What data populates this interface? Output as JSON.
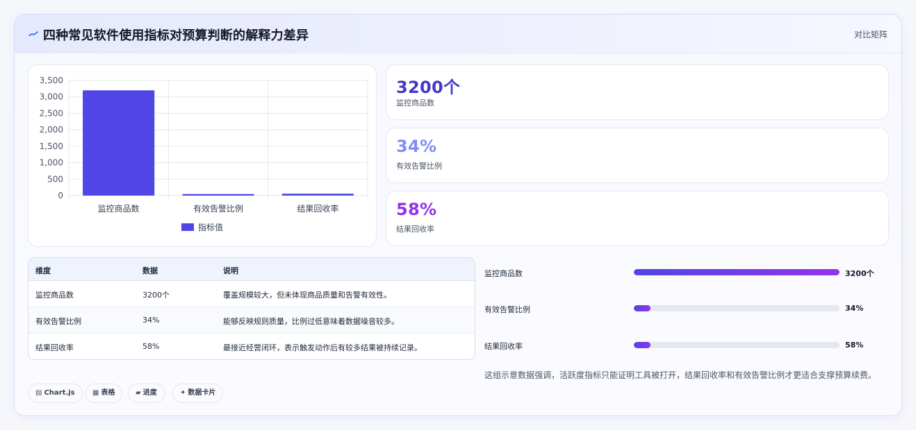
{
  "header": {
    "title": "四种常见软件使用指标对预算判断的解释力差异",
    "tag": "对比矩阵"
  },
  "chart_data": {
    "type": "bar",
    "categories": [
      "监控商品数",
      "有效告警比例",
      "结果回收率"
    ],
    "series": [
      {
        "name": "指标值",
        "values": [
          3200,
          34,
          58
        ]
      }
    ],
    "ylim": [
      0,
      3500
    ],
    "yticks": [
      0,
      500,
      1000,
      1500,
      2000,
      2500,
      3000,
      3500
    ],
    "ytick_labels": [
      "0",
      "500",
      "1,000",
      "1,500",
      "2,000",
      "2,500",
      "3,000",
      "3,500"
    ],
    "grid": true,
    "legend": "bottom",
    "color": "#4f46e5"
  },
  "kpis": [
    {
      "value": "3200个",
      "label": "监控商品数",
      "color": "#4338ca"
    },
    {
      "value": "34%",
      "label": "有效告警比例",
      "color": "#818cf8"
    },
    {
      "value": "58%",
      "label": "结果回收率",
      "color": "#9333ea"
    }
  ],
  "table": {
    "headers": [
      "维度",
      "数据",
      "说明"
    ],
    "rows": [
      [
        "监控商品数",
        "3200个",
        "覆盖规模较大，但未体现商品质量和告警有效性。"
      ],
      [
        "有效告警比例",
        "34%",
        "能够反映规则质量，比例过低意味着数据噪音较多。"
      ],
      [
        "结果回收率",
        "58%",
        "最接近经营闭环，表示触发动作后有较多结果被持续记录。"
      ]
    ]
  },
  "progress": [
    {
      "label": "监控商品数",
      "value": "3200个",
      "fraction": 1.0
    },
    {
      "label": "有效告警比例",
      "value": "34%",
      "fraction": 0.08
    },
    {
      "label": "结果回收率",
      "value": "58%",
      "fraction": 0.08
    }
  ],
  "note": "这组示意数据强调，活跃度指标只能证明工具被打开，结果回收率和有效告警比例才更适合支撑预算续费。",
  "chips": [
    {
      "icon": "▤",
      "label": "Chart.js"
    },
    {
      "icon": "▦",
      "label": "表格"
    },
    {
      "icon": "▰",
      "label": "进度"
    },
    {
      "icon": "✦",
      "label": "数据卡片"
    }
  ]
}
